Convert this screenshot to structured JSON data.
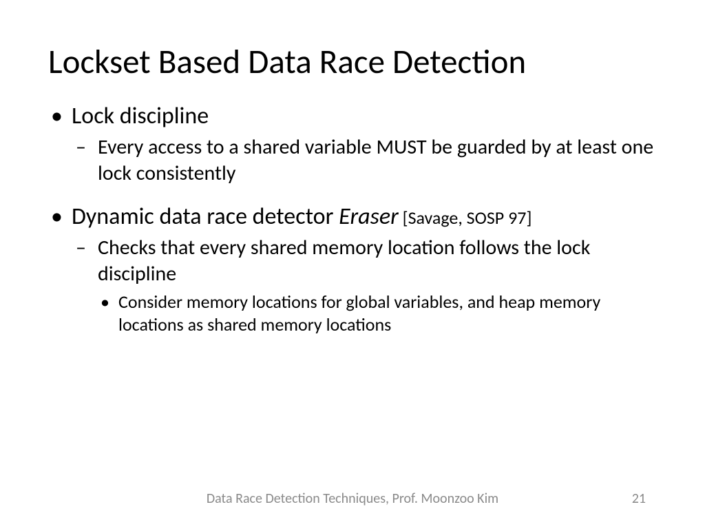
{
  "title": "Lockset Based Data Race Detection",
  "bullets": {
    "b1": "Lock discipline",
    "b1_1": "Every access to a shared variable MUST be guarded by at least one lock consistently",
    "b2_prefix": "Dynamic data race detector ",
    "b2_italic": "Eraser",
    "b2_cite": " [Savage, SOSP 97]",
    "b2_1": "Checks that every shared memory location follows the lock discipline",
    "b2_1_1": "Consider memory locations for global variables, and heap memory locations as shared memory locations"
  },
  "footer": "Data Race Detection Techniques, Prof. Moonzoo Kim",
  "page_number": "21"
}
